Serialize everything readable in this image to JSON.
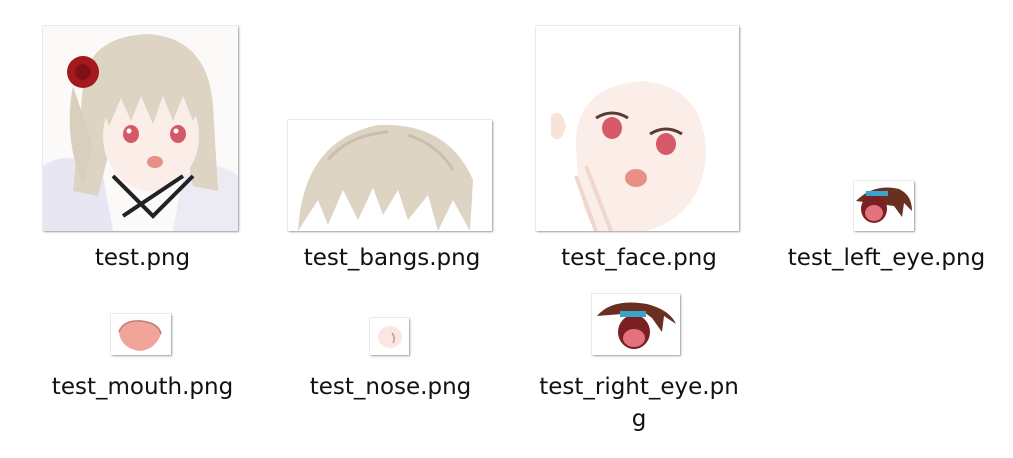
{
  "files": [
    {
      "name": "test.png",
      "thumbnail": "anime-girl-full-portrait"
    },
    {
      "name": "test_bangs.png",
      "thumbnail": "bangs-hair-layer"
    },
    {
      "name": "test_face.png",
      "thumbnail": "face-layer"
    },
    {
      "name": "test_left_eye.png",
      "thumbnail": "left-eye-layer"
    },
    {
      "name": "test_mouth.png",
      "thumbnail": "mouth-layer"
    },
    {
      "name": "test_nose.png",
      "thumbnail": "nose-layer"
    },
    {
      "name": "test_right_eye.pn",
      "name_wrap": "g",
      "thumbnail": "right-eye-layer"
    }
  ],
  "colors": {
    "hair": "#ddd4c3",
    "skin": "#fbeee8",
    "eye": "#d45a68",
    "rose": "#a3191d",
    "mouth": "#f0a49a"
  }
}
